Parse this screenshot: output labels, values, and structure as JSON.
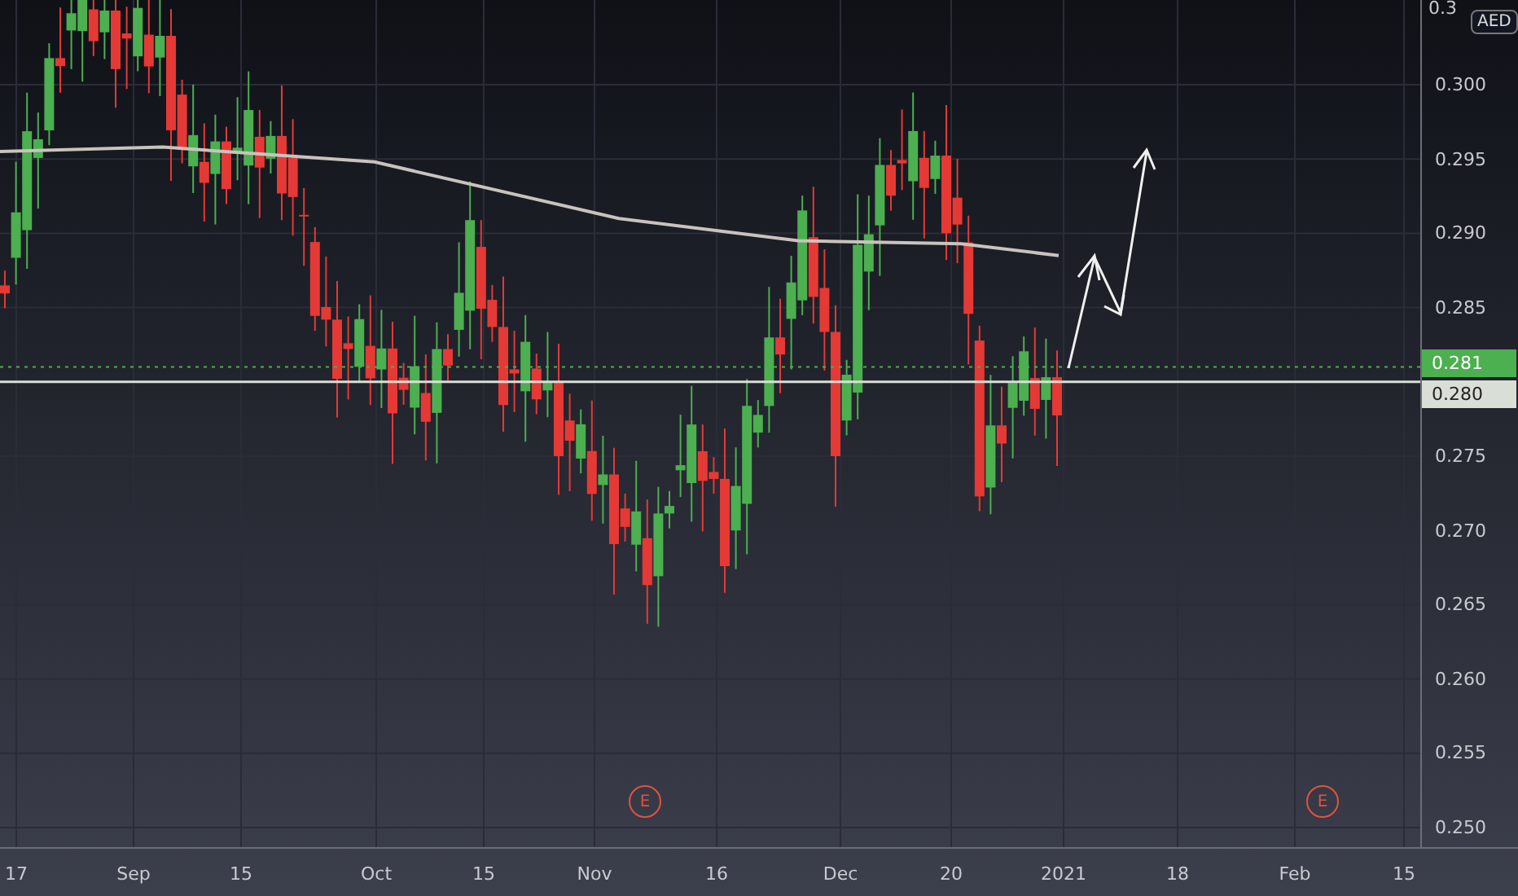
{
  "price_axis": {
    "currency": "AED",
    "cut_tick": "0.3",
    "ticks": [
      "0.300",
      "0.295",
      "0.290",
      "0.285",
      "0.275",
      "0.270",
      "0.265",
      "0.260",
      "0.255",
      "0.250"
    ],
    "price_labels": [
      {
        "text": "0.281",
        "color": "#4caf50"
      },
      {
        "text": "0.280",
        "color": "#d9dfd6"
      }
    ]
  },
  "time_axis": {
    "labels": [
      "17",
      "Sep",
      "15",
      "Oct",
      "15",
      "Nov",
      "16",
      "Dec",
      "20",
      "2021",
      "18",
      "Feb",
      "15"
    ]
  },
  "event_markers": [
    "E",
    "E"
  ]
}
